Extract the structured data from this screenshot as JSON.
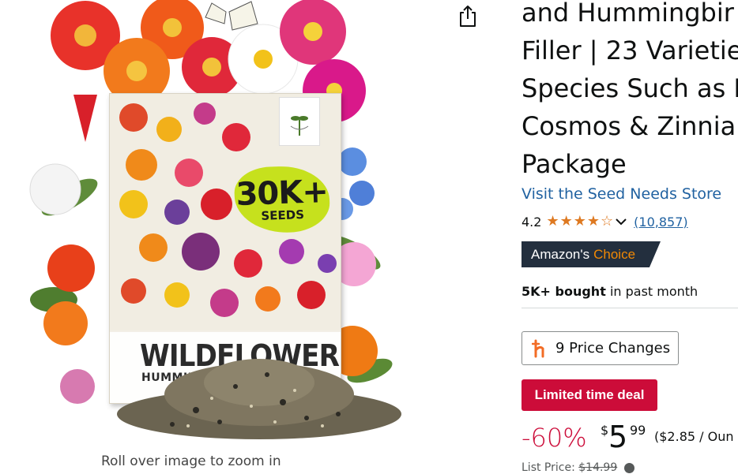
{
  "product_image": {
    "badge_main": "30K+",
    "badge_sub": "SEEDS",
    "packet_title": "WILDFLOWERS",
    "packet_subtitle": "HUMMINGBIRD",
    "zoom_hint": "Roll over image to zoom in"
  },
  "title_lines": [
    "and Hummingbir",
    "Filler | 23 Varietie",
    "Species Such as B",
    "Cosmos & Zinnia",
    "Package"
  ],
  "store_link": "Visit the Seed Needs Store",
  "rating": {
    "value": "4.2",
    "stars": 4.2,
    "count": "(10,857)",
    "star_color": "#de7921"
  },
  "badge": {
    "word1": "Amazon's",
    "word2": "Choice",
    "background": "#232f3e",
    "accent": "#f08804"
  },
  "bought": {
    "strong": "5K+ bought",
    "rest": "in past month"
  },
  "price_changes": {
    "label": "9 Price Changes",
    "icon": "honey-h-icon",
    "icon_color": "#f26c25"
  },
  "deal": {
    "label": "Limited time deal",
    "background": "#cc0c39"
  },
  "price": {
    "discount": "-60%",
    "currency": "$",
    "whole": "5",
    "fraction": "99",
    "unit": "($2.85 / Oun"
  },
  "list_price": {
    "label": "List Price:",
    "value": "$14.99"
  },
  "colors": {
    "link": "#2162a1",
    "text": "#0f1111"
  }
}
